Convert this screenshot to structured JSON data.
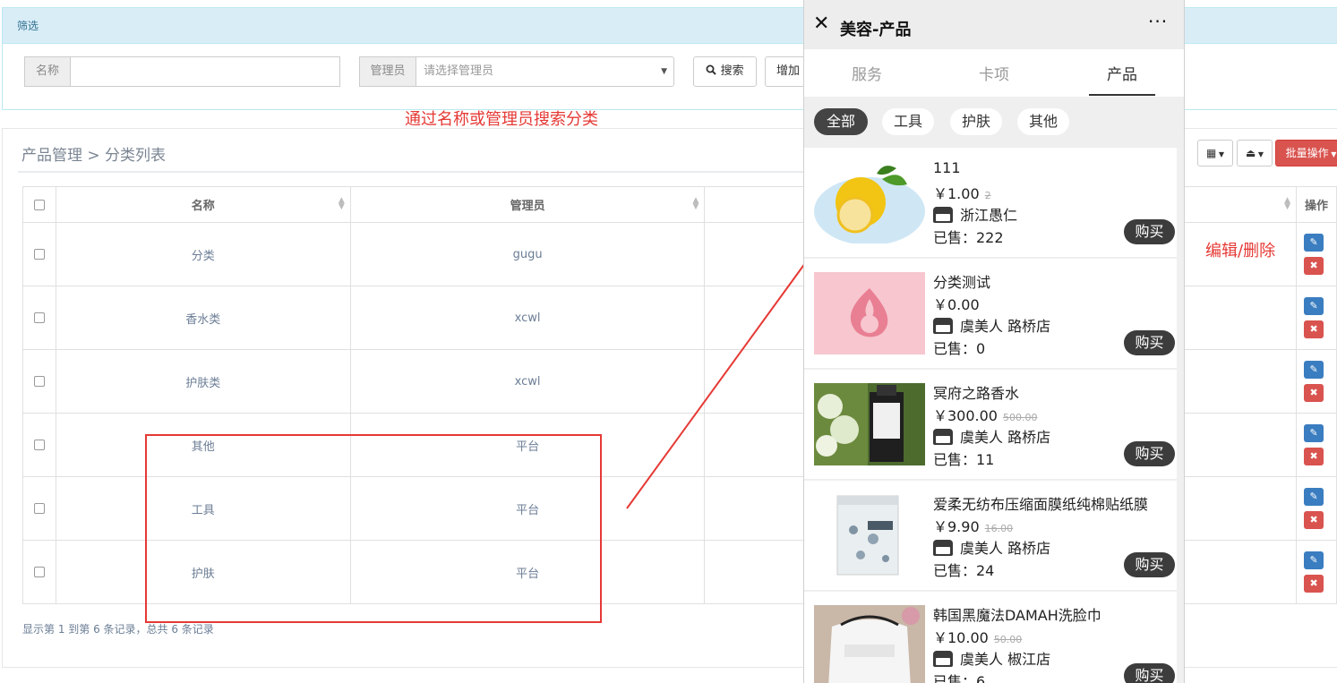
{
  "filter": {
    "title": "筛选",
    "name_label": "名称",
    "name_value": "",
    "manager_label": "管理员",
    "manager_placeholder": "请选择管理员",
    "search_label": "搜索",
    "add_label": "增加"
  },
  "breadcrumb": "产品管理 > 分类列表",
  "toolbar": {
    "batch_label": "批量操作"
  },
  "table": {
    "headers": {
      "name": "名称",
      "manager": "管理员",
      "ops": "操作"
    },
    "rows": [
      {
        "name": "分类",
        "manager": "gugu"
      },
      {
        "name": "香水类",
        "manager": "xcwl"
      },
      {
        "name": "护肤类",
        "manager": "xcwl"
      },
      {
        "name": "其他",
        "manager": "平台"
      },
      {
        "name": "工具",
        "manager": "平台"
      },
      {
        "name": "护肤",
        "manager": "平台"
      }
    ],
    "footer": "显示第 1 到第 6 条记录，总共 6 条记录"
  },
  "annotations": {
    "search_note": "通过名称或管理员搜索分类",
    "edit_note": "编辑/删除"
  },
  "phone": {
    "title": "美容-产品",
    "more": "···",
    "tabs": [
      "服务",
      "卡项",
      "产品"
    ],
    "chips": [
      "全部",
      "工具",
      "护肤",
      "其他"
    ],
    "buy_label": "购买",
    "products": [
      {
        "name": "111",
        "price": "￥1.00",
        "old_price": "2",
        "shop": "浙江愚仁",
        "sold": "已售：222"
      },
      {
        "name": "分类测试",
        "price": "￥0.00",
        "old_price": "",
        "shop": "虞美人 路桥店",
        "sold": "已售：0"
      },
      {
        "name": "冥府之路香水",
        "price": "￥300.00",
        "old_price": "500.00",
        "shop": "虞美人 路桥店",
        "sold": "已售：11"
      },
      {
        "name": "爱柔无纺布压缩面膜纸纯棉贴纸膜",
        "price": "￥9.90",
        "old_price": "16.00",
        "shop": "虞美人 路桥店",
        "sold": "已售：24"
      },
      {
        "name": "韩国黑魔法DAMAH洗脸巾",
        "price": "￥10.00",
        "old_price": "50.00",
        "shop": "虞美人 椒江店",
        "sold": "已售：6"
      }
    ]
  },
  "colors": {
    "accent_red": "#e53935",
    "edit_blue": "#3a7dc0",
    "delete_red": "#d9534f"
  }
}
